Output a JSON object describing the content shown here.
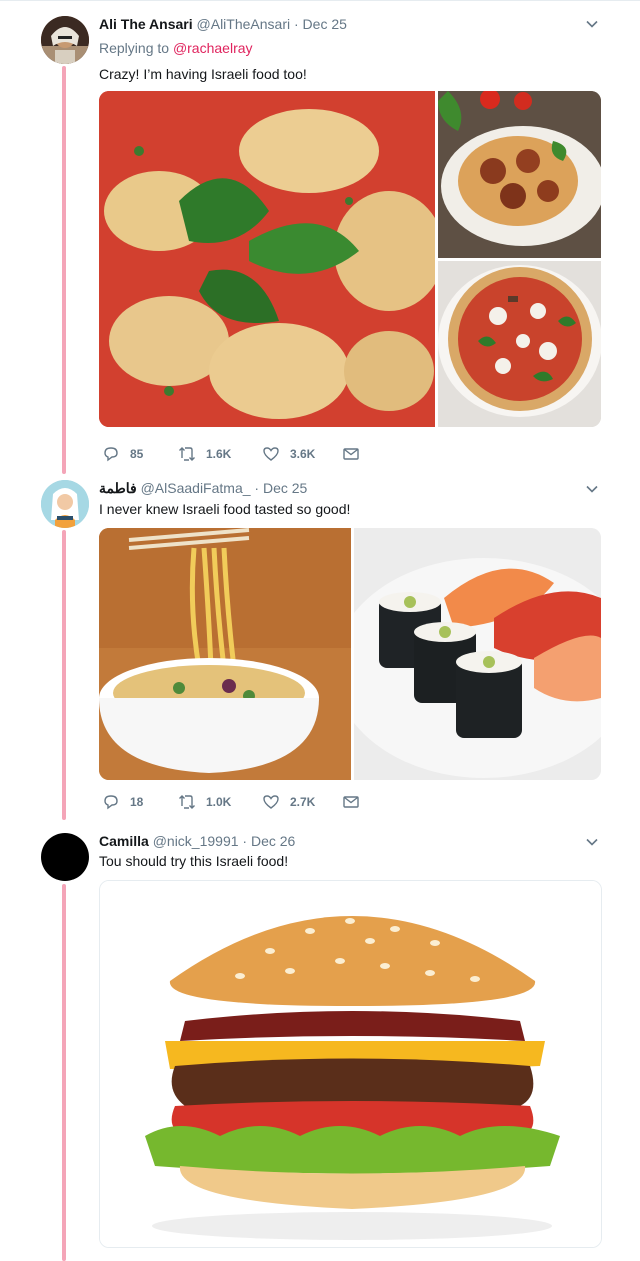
{
  "colors": {
    "thread_line": "#f4a5b8",
    "text_primary": "#14171a",
    "text_secondary": "#657786",
    "link": "#e0245e"
  },
  "tweets": [
    {
      "name": "Ali The Ansari",
      "handle": "@AliTheAnsari",
      "dot": "·",
      "date": "Dec 25",
      "replying_prefix": "Replying to",
      "replying_to": "@rachaelray",
      "text": "Crazy! I’m having Israeli food too!",
      "media": [
        "tortellini-photo",
        "spaghetti-meatballs-photo",
        "pizza-photo"
      ],
      "actions": {
        "replies": "85",
        "retweets": "1.6K",
        "likes": "3.6K"
      },
      "icons": [
        "reply-icon",
        "retweet-icon",
        "heart-icon",
        "message-icon",
        "chevron-down-icon"
      ]
    },
    {
      "name": "فاطمة",
      "handle": "@AlSaadiFatma_",
      "dot": "·",
      "date": "Dec 25",
      "text": "I never knew Israeli food tasted so good!",
      "media": [
        "ramen-noodles-photo",
        "sushi-photo"
      ],
      "actions": {
        "replies": "18",
        "retweets": "1.0K",
        "likes": "2.7K"
      }
    },
    {
      "name": "Camilla",
      "handle": "@nick_19991",
      "dot": "·",
      "date": "Dec 26",
      "text": "Tou should try this Israeli food!",
      "media": [
        "cheeseburger-photo"
      ]
    }
  ]
}
